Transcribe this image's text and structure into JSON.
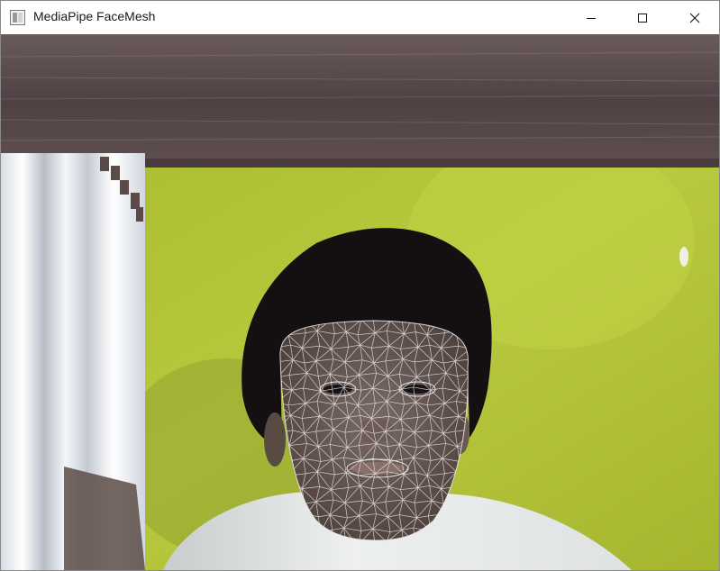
{
  "window": {
    "title": "MediaPipe FaceMesh",
    "app_icon": "opencv-window-icon",
    "controls": {
      "minimize_icon": "minimize-icon",
      "maximize_icon": "maximize-icon",
      "close_icon": "close-icon"
    }
  },
  "video_frame": {
    "content": "webcam-feed",
    "overlay": "face-mesh-landmarks",
    "mesh_color": "#e6e6e6",
    "colors": {
      "wall": "#b6c63a",
      "shelf": "#5a4a4c",
      "hair": "#141012",
      "shirt": "#e8eaea",
      "curtain": "#e4e8ee"
    }
  }
}
